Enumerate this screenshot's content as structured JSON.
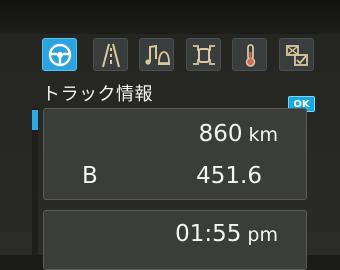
{
  "icons": [
    {
      "name": "steering-wheel-icon",
      "active": true
    },
    {
      "name": "road-lane-icon",
      "active": false
    },
    {
      "name": "music-bell-icon",
      "active": false
    },
    {
      "name": "vehicle-arrows-icon",
      "active": false
    },
    {
      "name": "thermometer-icon",
      "active": false
    },
    {
      "name": "settings-check-icon",
      "active": false
    }
  ],
  "header": {
    "title": "トラック情報"
  },
  "ok_button": {
    "label": "OK"
  },
  "odometer": {
    "value": "860",
    "unit": "km"
  },
  "trip": {
    "label": "B",
    "value": "451.6"
  },
  "clock": {
    "time": "01:55",
    "period": "pm"
  },
  "colors": {
    "accent": "#2aa3df",
    "background": "#242522",
    "panel": "#3b3d3a"
  }
}
